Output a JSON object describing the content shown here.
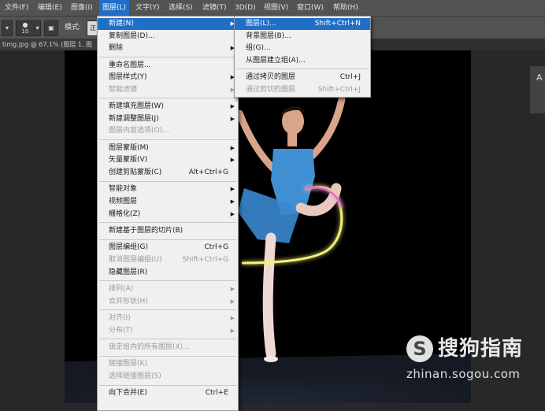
{
  "menubar": {
    "items": [
      "文件(F)",
      "编辑(E)",
      "图像(I)",
      "图层(L)",
      "文字(Y)",
      "选择(S)",
      "滤镜(T)",
      "3D(D)",
      "视图(V)",
      "窗口(W)",
      "帮助(H)"
    ],
    "active": "图层(L)"
  },
  "options": {
    "brush_size": "10",
    "mode_label": "模式:",
    "mode_value": "正"
  },
  "document": {
    "tab_title": "timg.jpg @ 67.1% (图层 1, 图",
    "panel_glyph": "A"
  },
  "layer_menu": [
    {
      "label": "新建(N)",
      "submenu": true,
      "highlight": true
    },
    {
      "label": "复制图层(D)..."
    },
    {
      "label": "删除",
      "submenu": true
    },
    {
      "sep": true
    },
    {
      "label": "重命名图层..."
    },
    {
      "label": "图层样式(Y)",
      "submenu": true
    },
    {
      "label": "智能滤镜",
      "submenu": true,
      "disabled": true
    },
    {
      "sep": true
    },
    {
      "label": "新建填充图层(W)",
      "submenu": true
    },
    {
      "label": "新建调整图层(J)",
      "submenu": true
    },
    {
      "label": "图层内容选项(O)...",
      "disabled": true
    },
    {
      "sep": true
    },
    {
      "label": "图层蒙版(M)",
      "submenu": true
    },
    {
      "label": "矢量蒙版(V)",
      "submenu": true
    },
    {
      "label": "创建剪贴蒙版(C)",
      "shortcut": "Alt+Ctrl+G"
    },
    {
      "sep": true
    },
    {
      "label": "智能对象",
      "submenu": true
    },
    {
      "label": "视频图层",
      "submenu": true
    },
    {
      "label": "栅格化(Z)",
      "submenu": true
    },
    {
      "sep": true
    },
    {
      "label": "新建基于图层的切片(B)"
    },
    {
      "sep": true
    },
    {
      "label": "图层编组(G)",
      "shortcut": "Ctrl+G"
    },
    {
      "label": "取消图层编组(U)",
      "shortcut": "Shift+Ctrl+G",
      "disabled": true
    },
    {
      "label": "隐藏图层(R)"
    },
    {
      "sep": true
    },
    {
      "label": "排列(A)",
      "submenu": true,
      "disabled": true
    },
    {
      "label": "合并形状(H)",
      "submenu": true,
      "disabled": true
    },
    {
      "sep": true
    },
    {
      "label": "对齐(I)",
      "submenu": true,
      "disabled": true
    },
    {
      "label": "分布(T)",
      "submenu": true,
      "disabled": true
    },
    {
      "sep": true
    },
    {
      "label": "锁定组内的所有图层(X)...",
      "disabled": true
    },
    {
      "sep": true
    },
    {
      "label": "链接图层(K)",
      "disabled": true
    },
    {
      "label": "选择链接图层(S)",
      "disabled": true
    },
    {
      "sep": true
    },
    {
      "label": "向下合并(E)",
      "shortcut": "Ctrl+E"
    }
  ],
  "new_submenu": [
    {
      "label": "图层(L)...",
      "shortcut": "Shift+Ctrl+N",
      "highlight": true
    },
    {
      "label": "背景图层(B)..."
    },
    {
      "label": "组(G)..."
    },
    {
      "label": "从图层建立组(A)..."
    },
    {
      "sep": true
    },
    {
      "label": "通过拷贝的图层",
      "shortcut": "Ctrl+J"
    },
    {
      "label": "通过剪切的图层",
      "shortcut": "Shift+Ctrl+J",
      "disabled": true
    }
  ],
  "watermark": {
    "badge": "S",
    "name": "搜狗指南",
    "url": "zhinan.sogou.com"
  },
  "colors": {
    "highlight": "#1f6fc9",
    "menu_bg": "#f0f0f0",
    "glow": "#f3f07a",
    "leotard": "#3f8fd2"
  }
}
